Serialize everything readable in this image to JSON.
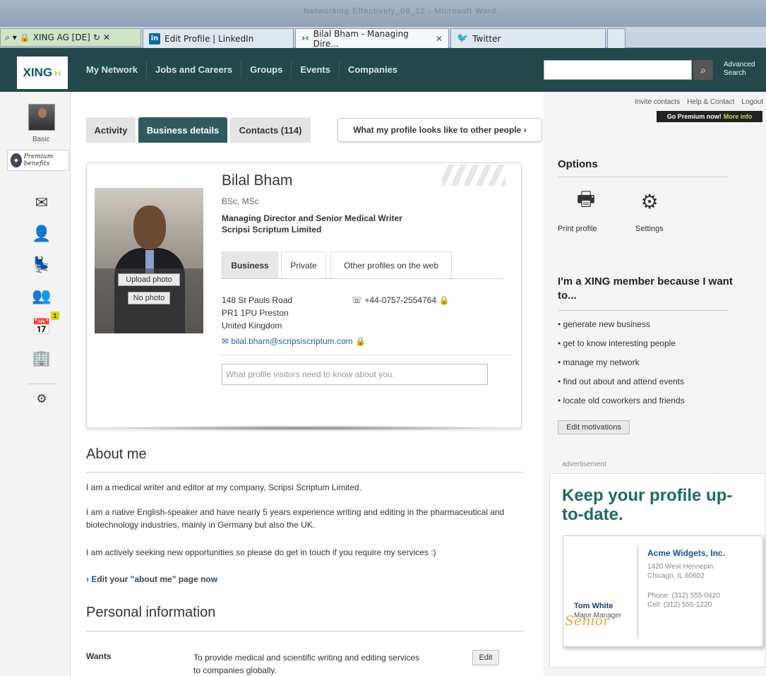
{
  "browser": {
    "title": "Networking Effectively_08_12 - Microsoft Word",
    "address_site": "XING AG [DE]",
    "tabs": [
      {
        "label": "Edit Profile | LinkedIn"
      },
      {
        "label": "Bilal Bham - Managing Dire..."
      },
      {
        "label": "Twitter"
      }
    ]
  },
  "xing": {
    "logo": "XING",
    "nav": [
      "My Network",
      "Jobs and Careers",
      "Groups",
      "Events",
      "Companies"
    ],
    "search_placeholder": "",
    "advanced_search": "Advanced Search"
  },
  "sidebar": {
    "membership": "Basic",
    "premium_label": "Premium benefits",
    "notification_count": "1"
  },
  "toplinks": {
    "items": [
      "Invite contacts",
      "Help & Contact",
      "Logout"
    ],
    "premium_cta": "Go Premium now!",
    "premium_more": "More info"
  },
  "profile_tabs": {
    "activity": "Activity",
    "business": "Business details",
    "contacts": "Contacts (114)",
    "view_as": "What my profile looks like to other people"
  },
  "profile": {
    "name": "Bilal Bham",
    "degrees": "BSc, MSc",
    "position": "Managing Director and Senior Medical Writer",
    "company": "Scripsi Scriptum Limited",
    "upload_photo": "Upload photo",
    "no_photo": "No photo",
    "info_tabs": [
      "Business",
      "Private",
      "Other profiles on the web"
    ],
    "address": [
      "148 St Pauls Road",
      "PR1 1PU Preston",
      "United Kingdom"
    ],
    "phone": "+44-0757-2554764",
    "email": "bilal.bham@scripsiscriptum.com",
    "visitors_placeholder": "What profile visitors need to know about you."
  },
  "about": {
    "heading": "About me",
    "paragraphs": [
      "I am a medical writer and editor at my company, Scripsi Scriptum Limited.",
      "I am a native English-speaker and have nearly 5 years experience writing and editing in the pharmaceutical and biotechnology industries, mainly in Germany but also the UK.",
      "I am actively seeking new opportunities so please do get in touch if you require my services :)"
    ],
    "edit_link": "Edit your \"about me\" page now"
  },
  "personal": {
    "heading": "Personal information",
    "wants_label": "Wants",
    "wants_value": "To provide medical and scientific writing and editing services to companies globally.",
    "edit": "Edit"
  },
  "options": {
    "heading": "Options",
    "print": "Print profile",
    "settings": "Settings"
  },
  "motivations": {
    "heading": "I'm a XING member because I want to...",
    "items": [
      "generate new business",
      "get to know interesting people",
      "manage my network",
      "find out about and attend events",
      "locate old coworkers and friends"
    ],
    "edit": "Edit motivations"
  },
  "ad": {
    "label": "advertisement",
    "headline": "Keep your profile up-to-date.",
    "company": "Acme Widgets, Inc.",
    "address1": "1420 West Hennepin",
    "address2": "Chicago, IL 60602",
    "phone": "Phone: (312) 555-0420",
    "cell": "Cell:  (312) 555-1220",
    "person": "Tom White",
    "role": "Major Manager",
    "stamp": "Senior"
  }
}
